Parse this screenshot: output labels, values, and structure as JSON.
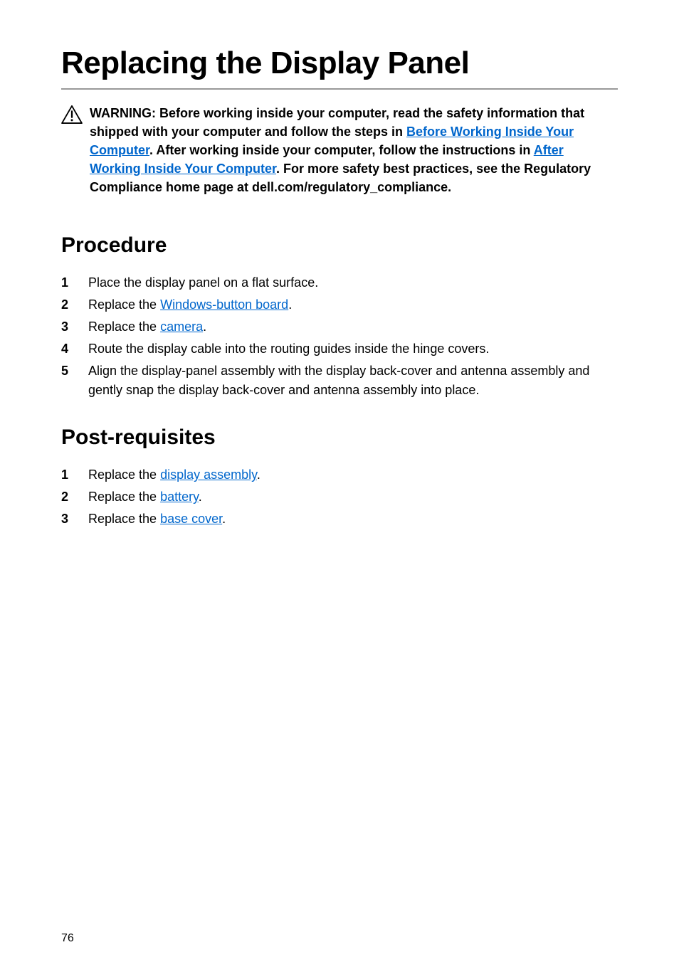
{
  "title": "Replacing the Display Panel",
  "warning": {
    "part1": "WARNING: Before working inside your computer, read the safety information that shipped with your computer and follow the steps in ",
    "link1": "Before Working Inside Your Computer",
    "part2": ". After working inside your computer, follow the instructions in ",
    "link2": "After Working Inside Your Computer",
    "part3": ". For more safety best practices, see the Regulatory Compliance home page at dell.com/regulatory_compliance."
  },
  "procedure": {
    "heading": "Procedure",
    "items": [
      {
        "num": "1",
        "text": "Place the display panel on a flat surface."
      },
      {
        "num": "2",
        "prefix": "Replace the ",
        "link": "Windows-button board",
        "suffix": "."
      },
      {
        "num": "3",
        "prefix": "Replace the ",
        "link": "camera",
        "suffix": "."
      },
      {
        "num": "4",
        "text": "Route the display cable into the routing guides inside the hinge covers."
      },
      {
        "num": "5",
        "text": "Align the display-panel assembly with the display back-cover and antenna assembly and gently snap the display back-cover and antenna assembly into place."
      }
    ]
  },
  "postreq": {
    "heading": "Post-requisites",
    "items": [
      {
        "num": "1",
        "prefix": "Replace the ",
        "link": "display assembly",
        "suffix": "."
      },
      {
        "num": "2",
        "prefix": "Replace the ",
        "link": "battery",
        "suffix": "."
      },
      {
        "num": "3",
        "prefix": "Replace the ",
        "link": "base cover",
        "suffix": "."
      }
    ]
  },
  "pageNumber": "76"
}
